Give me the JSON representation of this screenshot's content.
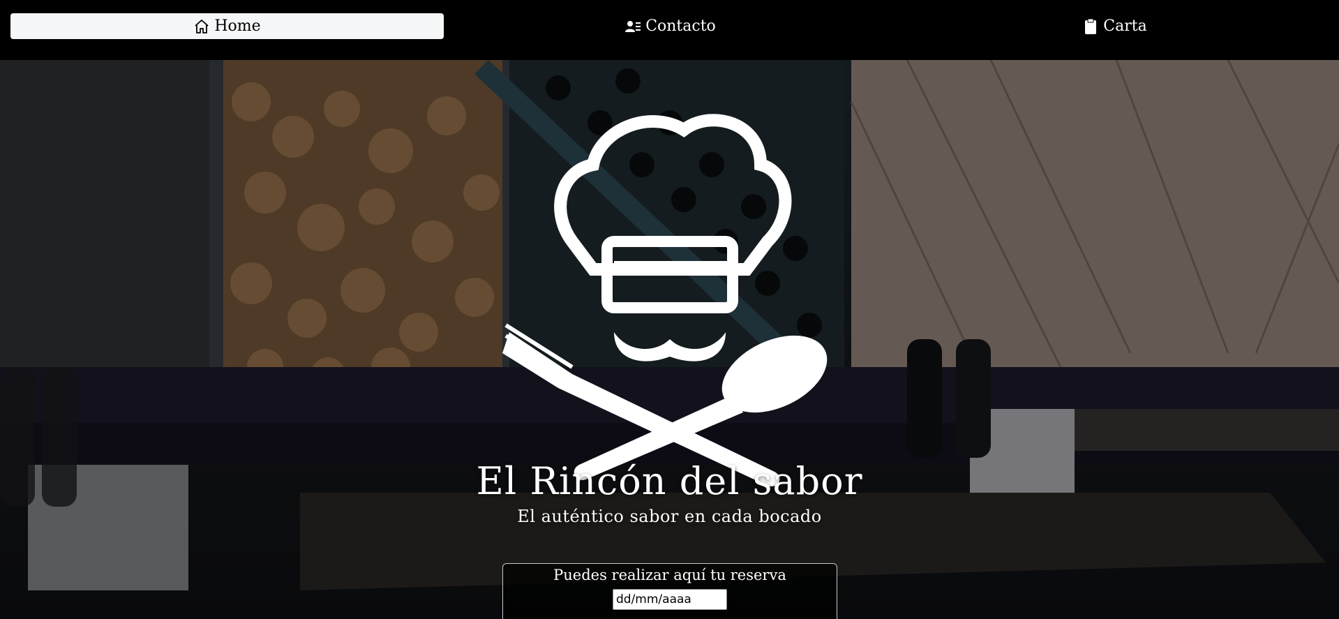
{
  "nav": {
    "items": [
      {
        "label": "Home",
        "icon": "home-icon",
        "active": true
      },
      {
        "label": "Contacto",
        "icon": "contact-card-icon",
        "active": false
      },
      {
        "label": "Carta",
        "icon": "clipboard-icon",
        "active": false
      }
    ]
  },
  "hero": {
    "logo_icon": "chef-hat-mustache-utensils-logo",
    "title": "El Rincón del sabor",
    "subtitle": "El auténtico sabor en cada bocado"
  },
  "reserva": {
    "title": "Puedes realizar aquí tu reserva",
    "date_value": "dd/mm/aaaa"
  },
  "colors": {
    "nav_bg": "#000000",
    "nav_active_bg": "#f6f7f9",
    "text": "#ffffff"
  }
}
